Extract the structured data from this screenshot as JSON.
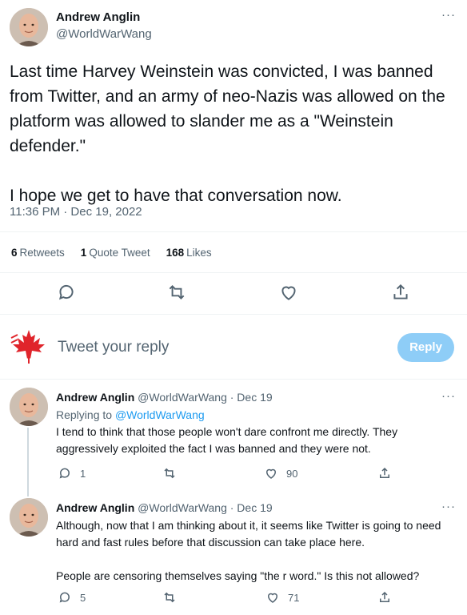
{
  "main_tweet": {
    "author_name": "Andrew Anglin",
    "author_handle": "@WorldWarWang",
    "text": "Last time Harvey Weinstein was convicted, I was banned from Twitter, and an army of neo-Nazis was allowed on the platform was allowed to slander me as a \"Weinstein defender.\"\n\nI hope we get to have that conversation now.",
    "timestamp": "11:36 PM · Dec 19, 2022",
    "more_icon": "···"
  },
  "stats": {
    "retweets_count": "6",
    "retweets_label": "Retweets",
    "quote_count": "1",
    "quote_label": "Quote Tweet",
    "likes_count": "168",
    "likes_label": "Likes"
  },
  "composer": {
    "placeholder": "Tweet your reply",
    "reply_button": "Reply"
  },
  "replies": [
    {
      "author_name": "Andrew Anglin",
      "author_handle": "@WorldWarWang · Dec 19",
      "replying_prefix": "Replying to ",
      "replying_handle": "@WorldWarWang",
      "text": "I tend to think that those people won't dare confront me directly. They aggressively exploited the fact I was banned and they were not.",
      "reply_count": "1",
      "retweet_count": "",
      "like_count": "90",
      "more_icon": "···"
    },
    {
      "author_name": "Andrew Anglin",
      "author_handle": "@WorldWarWang · Dec 19",
      "text": "Although, now that I am thinking about it, it seems like Twitter is going to need hard and fast rules before that discussion can take place here.\n\nPeople are censoring themselves saying \"the r word.\" Is this not allowed?",
      "reply_count": "5",
      "retweet_count": "",
      "like_count": "71",
      "more_icon": "···"
    }
  ],
  "colors": {
    "accent": "#1d9bf0",
    "reply_button_bg": "#8ecdf7",
    "secondary_text": "#536471",
    "leaf_red": "#e0242b"
  }
}
